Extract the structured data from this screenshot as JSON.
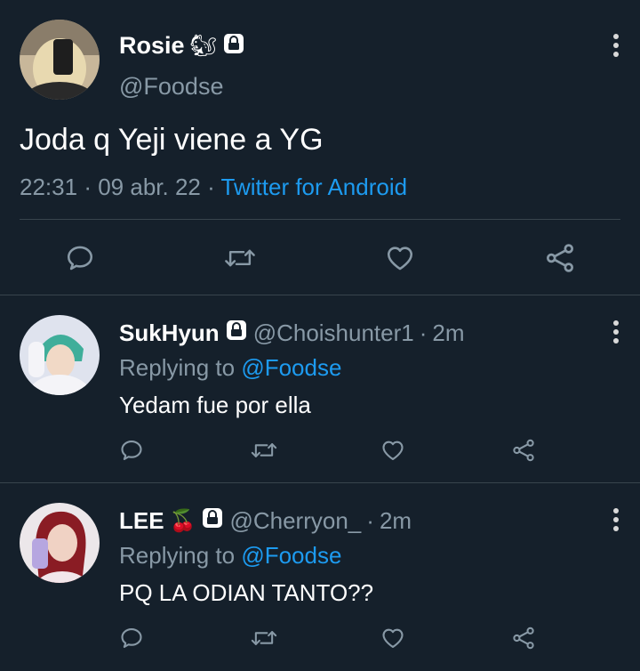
{
  "main_tweet": {
    "author_name": "Rosie",
    "author_emoji": "🐿",
    "handle": "@Foodse",
    "text": "Joda q Yeji viene a YG",
    "time": "22:31",
    "separator1": "·",
    "date": "09 abr. 22",
    "separator2": "·",
    "source": "Twitter for Android"
  },
  "replies": [
    {
      "author_name": "SukHyun",
      "handle": "@Choishunter1",
      "separator": "·",
      "age": "2m",
      "replying_prefix": "Replying to",
      "replying_to": "@Foodse",
      "text": "Yedam fue por ella"
    },
    {
      "author_name": "LEE",
      "author_emoji": "🍒",
      "handle": "@Cherryon_",
      "separator": "·",
      "age": "2m",
      "replying_prefix": "Replying to",
      "replying_to": "@Foodse",
      "text": "PQ LA ODIAN TANTO??"
    }
  ],
  "colors": {
    "background": "#15202b",
    "divider": "#38444d",
    "muted": "#8899a6",
    "link": "#1d9bf0",
    "icon": "#8899a6"
  },
  "icons": [
    "reply-icon",
    "retweet-icon",
    "like-icon",
    "share-icon",
    "lock-icon",
    "more-icon"
  ]
}
